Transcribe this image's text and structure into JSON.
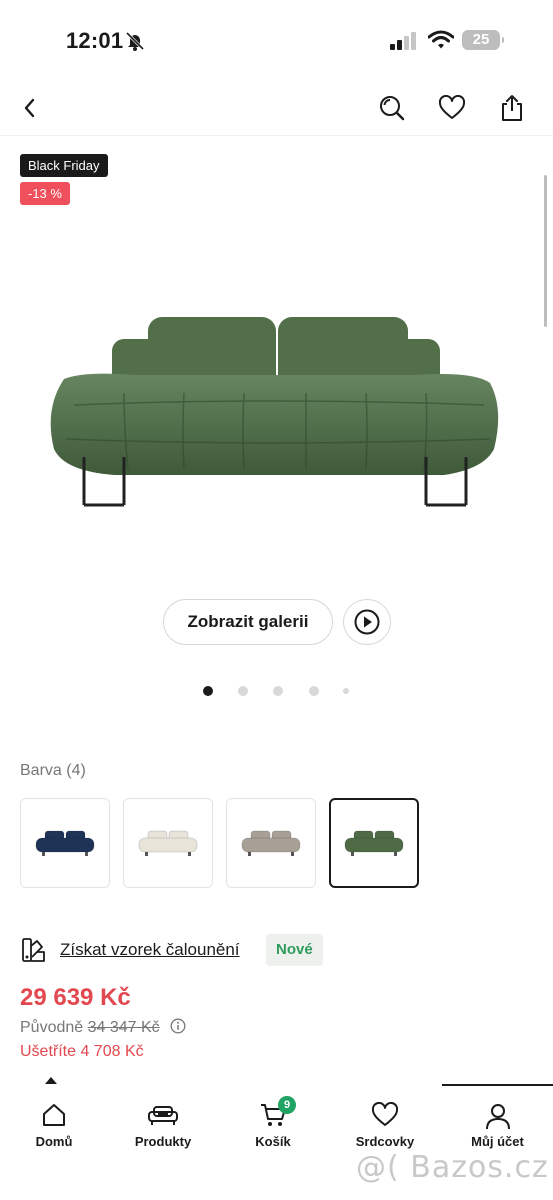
{
  "status_bar": {
    "time": "12:01",
    "battery": "25"
  },
  "top_nav": {
    "icons": [
      "back-icon",
      "search-icon",
      "heart-icon",
      "share-icon"
    ]
  },
  "gallery": {
    "badges": {
      "promo": "Black Friday",
      "discount": "-13 %"
    },
    "gallery_button": "Zobrazit galerii",
    "dots_count": 5,
    "active_dot": 0
  },
  "colors": {
    "label": "Barva (4)",
    "options": [
      {
        "name": "navy",
        "hex": "#1f3357"
      },
      {
        "name": "cream",
        "hex": "#e9e4da"
      },
      {
        "name": "beige",
        "hex": "#a8a096"
      },
      {
        "name": "green",
        "hex": "#4e6b45"
      }
    ],
    "selected_index": 3,
    "main_hex": "#526f49"
  },
  "sample": {
    "link_text": "Získat vzorek čalounění",
    "badge": "Nové",
    "badge_color": "#2e9c5a"
  },
  "price": {
    "current": "29 639 Kč",
    "original_label": "Původně",
    "original": "34 347 Kč",
    "savings": "Ušetříte 4 708 Kč",
    "accent": "#e2484f"
  },
  "bottom_nav": {
    "tabs": [
      {
        "label": "Domů",
        "icon": "home-icon"
      },
      {
        "label": "Produkty",
        "icon": "sofa-icon"
      },
      {
        "label": "Košík",
        "icon": "cart-icon",
        "badge": "9"
      },
      {
        "label": "Srdcovky",
        "icon": "heart-icon"
      },
      {
        "label": "Můj účet",
        "icon": "user-icon"
      }
    ],
    "active_index": 4
  },
  "watermark": "@( Bazos.cz"
}
